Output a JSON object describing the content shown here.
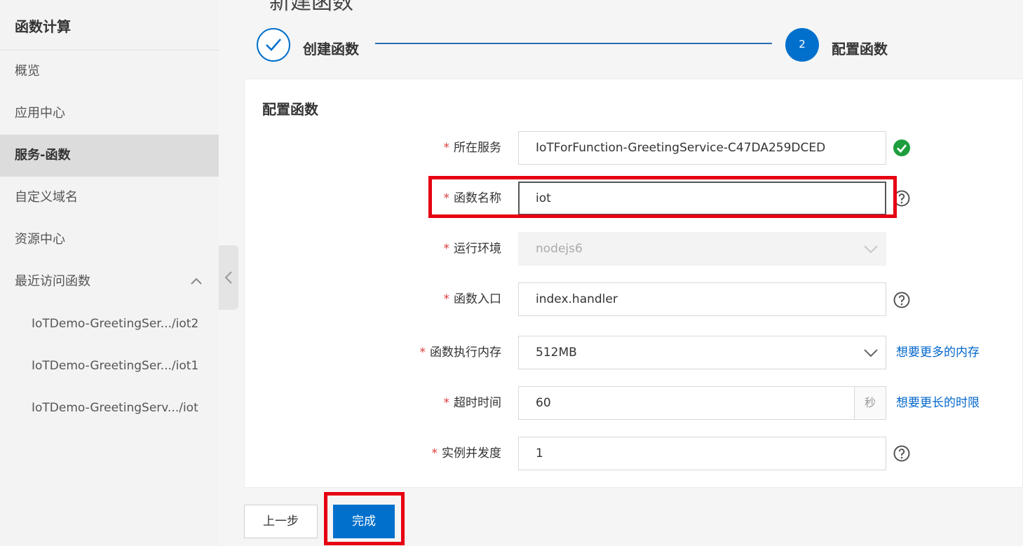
{
  "sidebar": {
    "title": "函数计算",
    "items": [
      {
        "label": "概览",
        "active": false
      },
      {
        "label": "应用中心",
        "active": false
      },
      {
        "label": "服务-函数",
        "active": true
      },
      {
        "label": "自定义域名",
        "active": false
      },
      {
        "label": "资源中心",
        "active": false
      },
      {
        "label": "最近访问函数",
        "active": false
      }
    ],
    "recent": [
      "IoTDemo-GreetingSer.../iot2",
      "IoTDemo-GreetingSer.../iot1",
      "IoTDemo-GreetingServ.../iot"
    ]
  },
  "header": {
    "title": "新建函数"
  },
  "steps": [
    {
      "label": "创建函数",
      "state": "done"
    },
    {
      "number": "2",
      "label": "配置函数",
      "state": "current"
    }
  ],
  "form": {
    "title": "配置函数",
    "required_mark": "*",
    "service": {
      "label": "所在服务",
      "value": "IoTForFunction-GreetingService-C47DA259DCED"
    },
    "name": {
      "label": "函数名称",
      "value": "iot"
    },
    "runtime": {
      "label": "运行环境",
      "value": "nodejs6"
    },
    "handler": {
      "label": "函数入口",
      "value": "index.handler"
    },
    "memory": {
      "label": "函数执行内存",
      "value": "512MB",
      "link": "想要更多的内存"
    },
    "timeout": {
      "label": "超时时间",
      "value": "60",
      "unit": "秒",
      "link": "想要更长的时限"
    },
    "concurrency": {
      "label": "实例并发度",
      "value": "1"
    }
  },
  "footer": {
    "prev_label": "上一步",
    "finish_label": "完成"
  },
  "colors": {
    "primary": "#0070cc",
    "highlight": "#e60012",
    "success": "#1e9e3e"
  }
}
